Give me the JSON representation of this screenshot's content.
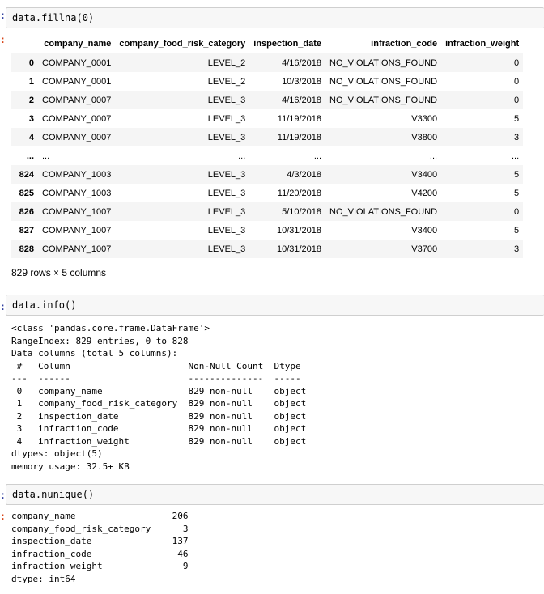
{
  "cell1": {
    "code": "data.fillna(0)",
    "columns": [
      "company_name",
      "company_food_risk_category",
      "inspection_date",
      "infraction_code",
      "infraction_weight"
    ],
    "rows": [
      {
        "index": "0",
        "values": [
          "COMPANY_0001",
          "LEVEL_2",
          "4/16/2018",
          "NO_VIOLATIONS_FOUND",
          "0"
        ]
      },
      {
        "index": "1",
        "values": [
          "COMPANY_0001",
          "LEVEL_2",
          "10/3/2018",
          "NO_VIOLATIONS_FOUND",
          "0"
        ]
      },
      {
        "index": "2",
        "values": [
          "COMPANY_0007",
          "LEVEL_3",
          "4/16/2018",
          "NO_VIOLATIONS_FOUND",
          "0"
        ]
      },
      {
        "index": "3",
        "values": [
          "COMPANY_0007",
          "LEVEL_3",
          "11/19/2018",
          "V3300",
          "5"
        ]
      },
      {
        "index": "4",
        "values": [
          "COMPANY_0007",
          "LEVEL_3",
          "11/19/2018",
          "V3800",
          "3"
        ]
      },
      {
        "index": "...",
        "values": [
          "...",
          "...",
          "...",
          "...",
          "..."
        ]
      },
      {
        "index": "824",
        "values": [
          "COMPANY_1003",
          "LEVEL_3",
          "4/3/2018",
          "V3400",
          "5"
        ]
      },
      {
        "index": "825",
        "values": [
          "COMPANY_1003",
          "LEVEL_3",
          "11/20/2018",
          "V4200",
          "5"
        ]
      },
      {
        "index": "826",
        "values": [
          "COMPANY_1007",
          "LEVEL_3",
          "5/10/2018",
          "NO_VIOLATIONS_FOUND",
          "0"
        ]
      },
      {
        "index": "827",
        "values": [
          "COMPANY_1007",
          "LEVEL_3",
          "10/31/2018",
          "V3400",
          "5"
        ]
      },
      {
        "index": "828",
        "values": [
          "COMPANY_1007",
          "LEVEL_3",
          "10/31/2018",
          "V3700",
          "3"
        ]
      }
    ],
    "shape": "829 rows × 5 columns"
  },
  "cell2": {
    "code": "data.info()",
    "output": "<class 'pandas.core.frame.DataFrame'>\nRangeIndex: 829 entries, 0 to 828\nData columns (total 5 columns):\n #   Column                      Non-Null Count  Dtype \n---  ------                      --------------  ----- \n 0   company_name                829 non-null    object\n 1   company_food_risk_category  829 non-null    object\n 2   inspection_date             829 non-null    object\n 3   infraction_code             829 non-null    object\n 4   infraction_weight           829 non-null    object\ndtypes: object(5)\nmemory usage: 32.5+ KB"
  },
  "cell3": {
    "code": "data.nunique()",
    "output": "company_name                  206\ncompany_food_risk_category      3\ninspection_date               137\ninfraction_code                46\ninfraction_weight               9\ndtype: int64"
  },
  "prompt": {
    "in_marker": ":",
    "out_marker": ":"
  },
  "colors": {
    "in_prompt": "#303f9f",
    "out_prompt": "#d84315",
    "cell_bg": "#f7f7f7",
    "stripe": "#f5f5f5"
  }
}
